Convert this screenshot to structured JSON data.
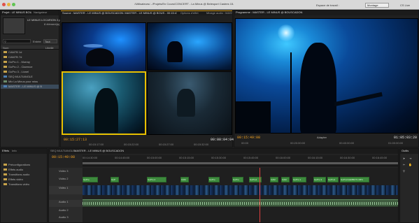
{
  "titlebar": {
    "title": "/Utilisateurs/.../Projets/En Cours/CONCERT - La Minus @ Belesport Castres 15-2012/LE MINUS BOUSCADON 2.prproj *",
    "workspace_label": "Espace de travail :",
    "workspace_value": "Montage",
    "live_label": "CS Live"
  },
  "project": {
    "tabs": [
      "Projet : LE MINUS BOUSCADON 2",
      "Navigateur",
      "Effets"
    ],
    "file_name": "LE MINUS LOCARION 2.prproj",
    "item_count": "8 élément(s)",
    "search_label": "Entrée",
    "search_value": "Tout",
    "header_name": "Nom",
    "header_label": "Libellé",
    "items": [
      "CAM7B 1d",
      "CAM7B 7d",
      "GoPro 1 - Murray",
      "GoPro 2 - Clarence",
      "GoPro 3 - Lionel",
      "SEQ MULTIANGLE",
      "Mix La Minus pour miss",
      "MASTER - LE MINUS @ B"
    ]
  },
  "source": {
    "tabs": [
      "Source : MASTER - LE MINUS @ BOUSCADON: MASTER - LE MINUS @ BOUS - 00:15:47:22",
      "Options d'effet",
      "Mixage audio : MASTER"
    ],
    "timecode": "00:15:27:13",
    "duration": "00:00:04:04",
    "ruler": [
      "00:15:17:00",
      "00:15:22:00",
      "00:15:27:00",
      "00:15:32:00"
    ]
  },
  "program": {
    "tab": "Programme : MASTER - LE MINUS @ BOUSCADON",
    "timecode": "00:15:49:08",
    "duration": "01:05:03:20",
    "fit": "Adapter",
    "ruler": [
      "00:00",
      "00:20:00:00",
      "00:40:00:00",
      "01:00:00:00"
    ]
  },
  "effects": {
    "tabs": [
      "Effets",
      "Info",
      "Historique"
    ],
    "items": [
      "Préconfigurations",
      "Effets audio",
      "Transitions audio",
      "Effets vidéo",
      "Transitions vidéo"
    ]
  },
  "timeline": {
    "tabs": [
      "SEQ MULTIANGLE",
      "MASTER - LE MINUS @ BOUSCADON"
    ],
    "timecode": "00:15:49:08",
    "ruler": [
      "00:14:30:00",
      "00:14:45:00",
      "00:15:00:00",
      "00:15:15:00",
      "00:15:30:00",
      "00:15:45:00",
      "00:16:00:00",
      "00:16:15:00",
      "00:16:30:00",
      "00:16:45:00"
    ],
    "tracks": [
      "Vidéo 3",
      "Vidéo 2",
      "Vidéo 1",
      "Audio 1",
      "Audio 2",
      "Audio 3"
    ],
    "clip_labels": [
      "GoPro",
      "GoP",
      "GoPro 2",
      "CAM",
      "GoPro",
      "GoPro",
      "GoPro1",
      "CAM",
      "CAM",
      "GoPro 1",
      "GoPro 3",
      "GoPro1",
      "GoProCLEMBCT1 MP4"
    ]
  },
  "tools": {
    "tabs": [
      "Outils"
    ]
  },
  "meters": {
    "labels": [
      "0",
      "-6",
      "-12",
      "-18",
      "-24",
      "-30",
      "-36",
      "-42",
      "-48",
      "-54"
    ]
  }
}
